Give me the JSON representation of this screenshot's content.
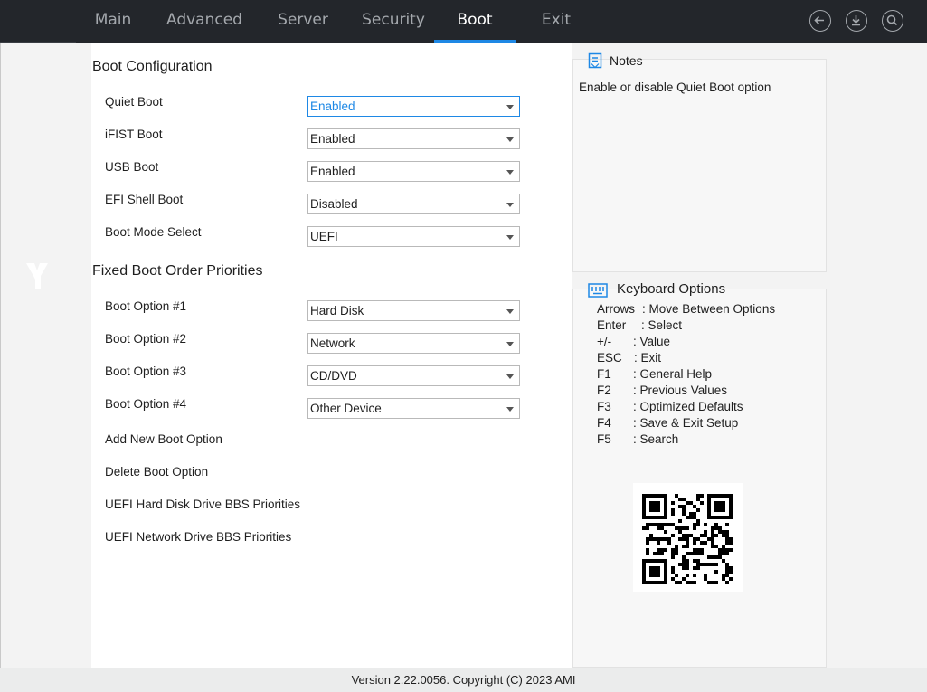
{
  "tabs": [
    {
      "label": "Main"
    },
    {
      "label": "Advanced"
    },
    {
      "label": "Server"
    },
    {
      "label": "Security"
    },
    {
      "label": "Boot"
    },
    {
      "label": "Exit"
    }
  ],
  "active_tab": "Boot",
  "top_icons": [
    "back-arrow-icon",
    "download-icon",
    "search-icon"
  ],
  "boot_config": {
    "title": "Boot Configuration",
    "rows": [
      {
        "label": "Quiet Boot",
        "value": "Enabled"
      },
      {
        "label": "iFIST Boot",
        "value": "Enabled"
      },
      {
        "label": "USB Boot",
        "value": "Enabled"
      },
      {
        "label": "EFI Shell Boot",
        "value": "Disabled"
      },
      {
        "label": "Boot Mode Select",
        "value": "UEFI"
      }
    ]
  },
  "boot_order": {
    "title": "Fixed Boot Order Priorities",
    "rows": [
      {
        "label": "Boot Option #1",
        "value": "Hard Disk"
      },
      {
        "label": "Boot Option #2",
        "value": "Network"
      },
      {
        "label": "Boot Option #3",
        "value": "CD/DVD"
      },
      {
        "label": "Boot Option #4",
        "value": "Other Device"
      }
    ],
    "links": [
      "Add New Boot Option",
      "Delete Boot Option",
      "UEFI Hard Disk Drive BBS Priorities",
      "UEFI Network Drive BBS Priorities"
    ]
  },
  "notes": {
    "title": "Notes",
    "text": "Enable or disable Quiet Boot option"
  },
  "keyboard": {
    "title": "Keyboard Options",
    "items": [
      {
        "key": "Arrows",
        "desc": ": Move Between Options"
      },
      {
        "key": "Enter",
        "desc": ": Select"
      },
      {
        "key": "+/-",
        "desc": ": Value"
      },
      {
        "key": "ESC",
        "desc": ": Exit"
      },
      {
        "key": "F1",
        "desc": ": General Help"
      },
      {
        "key": "F2",
        "desc": ": Previous Values"
      },
      {
        "key": "F3",
        "desc": ": Optimized Defaults"
      },
      {
        "key": "F4",
        "desc": ": Save & Exit Setup"
      },
      {
        "key": "F5",
        "desc": ": Search"
      }
    ]
  },
  "footer": {
    "text": "Version 2.22.0056. Copyright (C) 2023 AMI"
  },
  "colors": {
    "accent": "#1e88e5",
    "topbar": "#23262b",
    "tab_text": "#a4a8ad"
  }
}
